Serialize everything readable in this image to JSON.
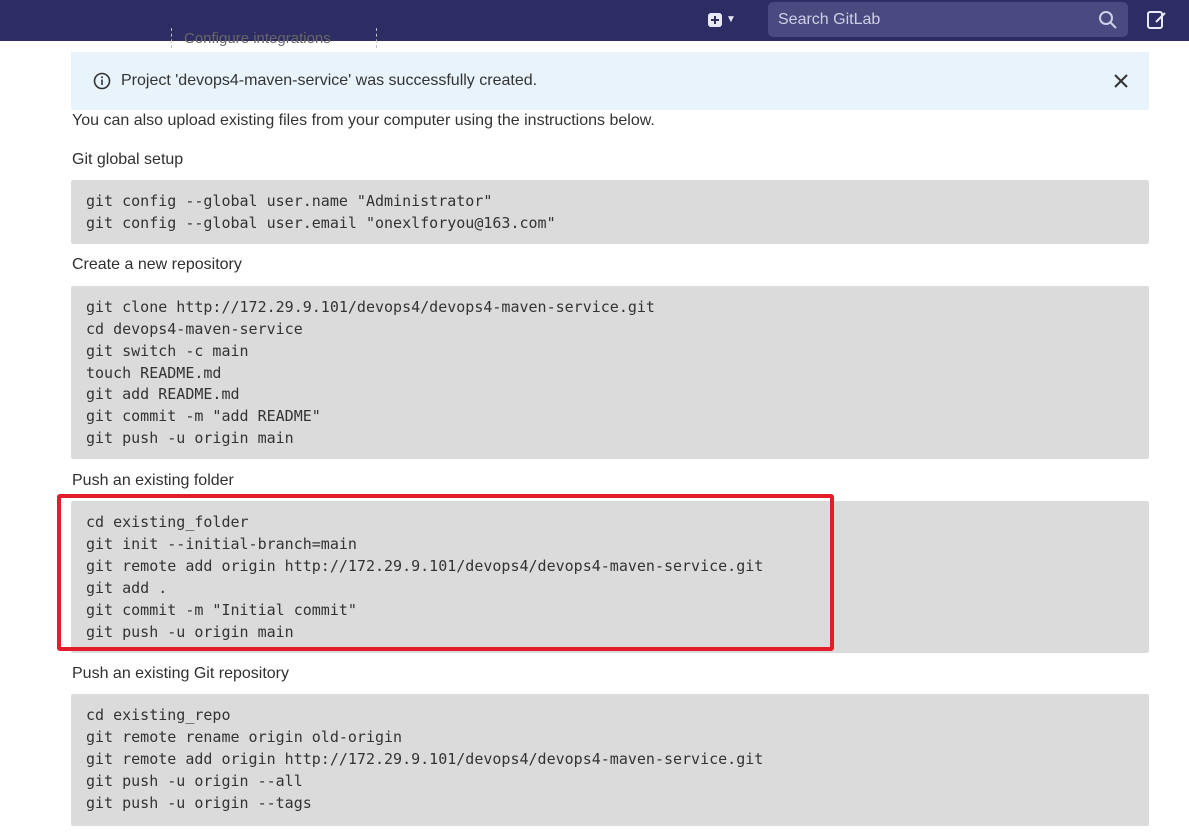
{
  "topbar": {
    "search_placeholder": "Search GitLab",
    "icons": [
      "plus-square-icon",
      "chevron-down-icon",
      "search-icon",
      "edit-icon"
    ]
  },
  "previous_item": {
    "label": "Configure integrations"
  },
  "alert": {
    "message": "Project 'devops4-maven-service' was successfully created.",
    "icons": [
      "info-icon",
      "close-icon"
    ]
  },
  "intro": "You can also upload existing files from your computer using the instructions below.",
  "sections": {
    "git_global_setup": {
      "title": "Git global setup",
      "lines": [
        "git config --global user.name \"Administrator\"",
        "git config --global user.email \"onexlforyou@163.com\""
      ]
    },
    "create_repo": {
      "title": "Create a new repository",
      "lines": [
        "git clone http://172.29.9.101/devops4/devops4-maven-service.git",
        "cd devops4-maven-service",
        "git switch -c main",
        "touch README.md",
        "git add README.md",
        "git commit -m \"add README\"",
        "git push -u origin main"
      ]
    },
    "push_folder": {
      "title": "Push an existing folder",
      "lines": [
        "cd existing_folder",
        "git init --initial-branch=main",
        "git remote add origin http://172.29.9.101/devops4/devops4-maven-service.git",
        "git add .",
        "git commit -m \"Initial commit\"",
        "git push -u origin main"
      ]
    },
    "push_repo": {
      "title": "Push an existing Git repository",
      "lines": [
        "cd existing_repo",
        "git remote rename origin old-origin",
        "git remote add origin http://172.29.9.101/devops4/devops4-maven-service.git",
        "git push -u origin --all",
        "git push -u origin --tags"
      ]
    }
  },
  "colors": {
    "topbar": "#2e2d63",
    "alert_bg": "#e9f3fc",
    "code_bg": "#dbdbdb",
    "highlight_border": "#e31e2c"
  }
}
